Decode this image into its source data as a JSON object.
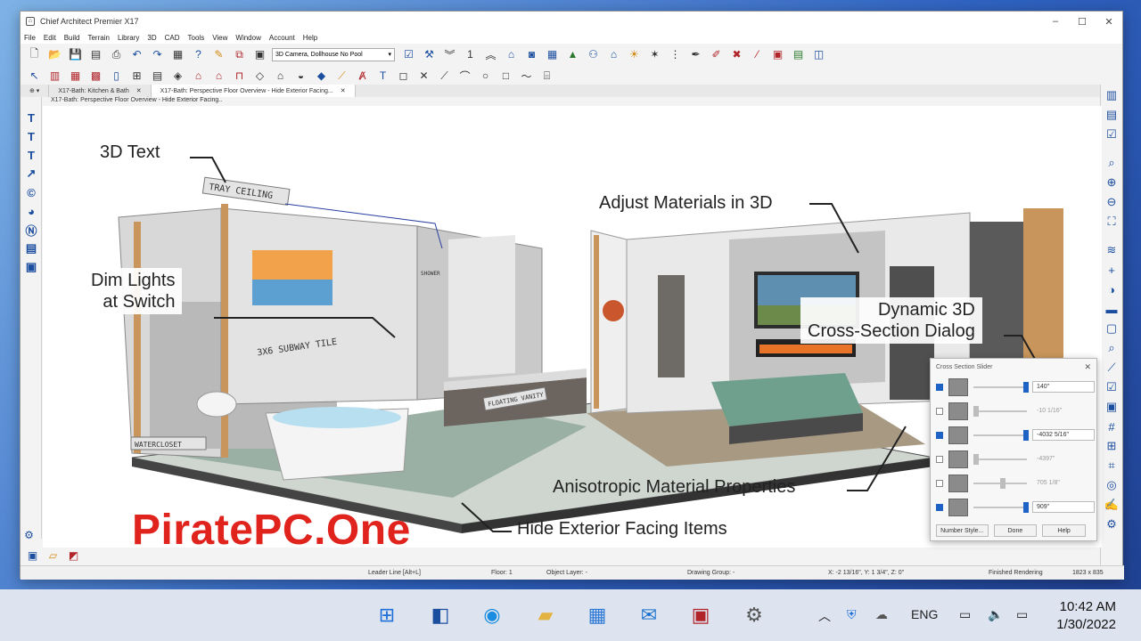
{
  "window": {
    "title": "Chief Architect Premier X17"
  },
  "menu": [
    "File",
    "Edit",
    "Build",
    "Terrain",
    "Library",
    "3D",
    "CAD",
    "Tools",
    "View",
    "Window",
    "Account",
    "Help"
  ],
  "toolbar": {
    "camera_select": "3D Camera, Dollhouse No Pool",
    "floor_number": "1"
  },
  "tabs": [
    {
      "label": "X17-Bath: Kitchen & Bath"
    },
    {
      "label": "X17-Bath: Perspective Floor Overview - Hide Exterior Facing..."
    }
  ],
  "view_label": "X17-Bath: Perspective Floor Overview - Hide Exterior Facing..",
  "callouts": {
    "text3d": "3D Text",
    "dim_lights_1": "Dim Lights",
    "dim_lights_2": "at Switch",
    "adjust_materials": "Adjust Materials in 3D",
    "dynamic_1": "Dynamic 3D",
    "dynamic_2": "Cross-Section Dialog",
    "aniso": "Anisotropic Material Properties",
    "hide_ext": "Hide Exterior Facing Items"
  },
  "scene_labels": {
    "tray_ceiling": "TRAY CEILING",
    "subway_tile": "3X6 SUBWAY TILE",
    "shower": "SHOWER",
    "floating_vanity": "FLOATING VANITY",
    "watercloset": "WATERCLOSET"
  },
  "watermark": "PiratePC.One",
  "dialog": {
    "title": "Cross Section Slider",
    "rows": [
      {
        "checked": true,
        "value": "140\""
      },
      {
        "checked": false,
        "value": "-10 1/16\""
      },
      {
        "checked": true,
        "value": "-4032 5/16\""
      },
      {
        "checked": false,
        "value": "-4397\""
      },
      {
        "checked": false,
        "value": "705 1/8\""
      },
      {
        "checked": true,
        "value": "909\""
      }
    ],
    "number_style": "Number Style...",
    "done": "Done",
    "help": "Help"
  },
  "status": {
    "tool": "Leader Line [Alt+L]",
    "floor": "Floor: 1",
    "layer": "Object Layer: -",
    "group": "Drawing Group: -",
    "coords": "X: -2 13/16\", Y: 1 3/4\", Z: 0\"",
    "render": "Finished Rendering",
    "size": "1823 x 835"
  },
  "taskbar": {
    "language": "ENG",
    "time": "10:42 AM",
    "date": "1/30/2022"
  }
}
